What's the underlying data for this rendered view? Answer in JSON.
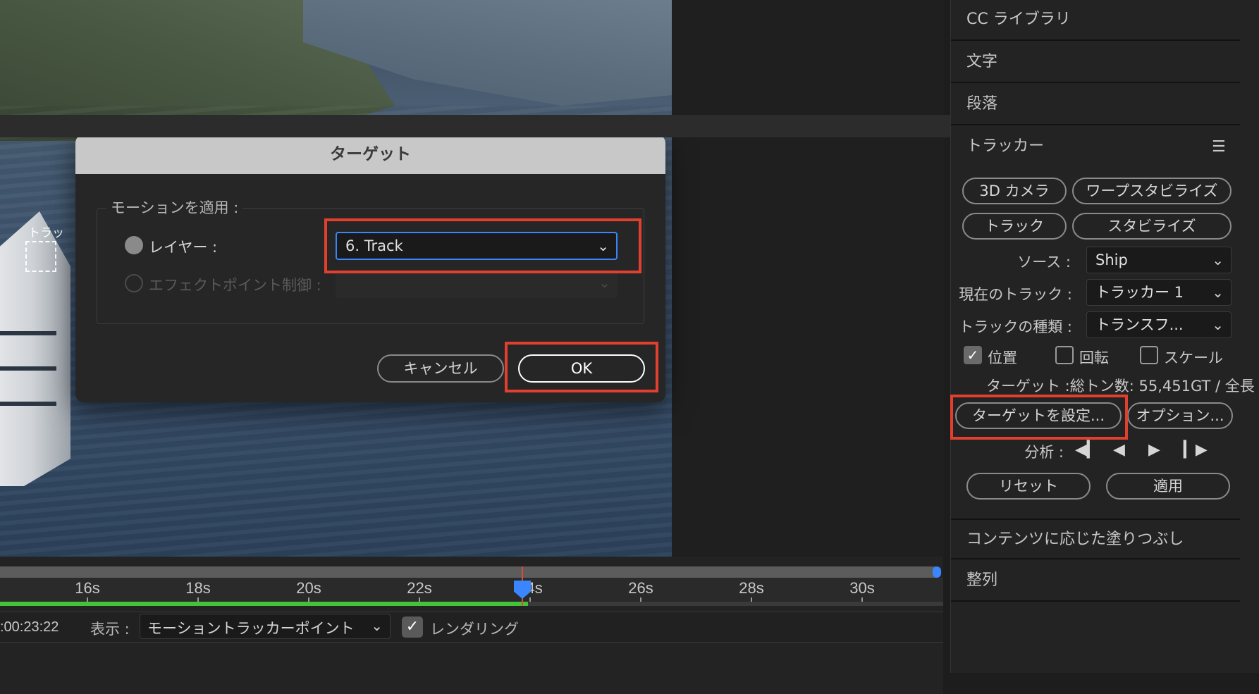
{
  "preview": {
    "track_label": "トラッ"
  },
  "timeline": {
    "ticks": [
      "16s",
      "18s",
      "20s",
      "22s",
      "24s",
      "26s",
      "28s",
      "30s"
    ],
    "timecode": ":00:23:22",
    "show_label": "表示 :",
    "show_value": "モーショントラッカーポイント",
    "render_label": "レンダリング",
    "render_checked": true,
    "rendered_fraction": 0.56
  },
  "panels": {
    "cc_library": "CC ライブラリ",
    "character": "文字",
    "paragraph": "段落",
    "tracker": "トラッカー",
    "content_aware_fill": "コンテンツに応じた塗りつぶし",
    "align": "整列"
  },
  "tracker": {
    "buttons": {
      "camera3d": "3D カメラ",
      "warp_stabilize": "ワープスタビライズ",
      "track": "トラック",
      "stabilize": "スタビライズ"
    },
    "source_label": "ソース :",
    "source_value": "Ship",
    "current_track_label": "現在のトラック :",
    "current_track_value": "トラッカー 1",
    "track_type_label": "トラックの種類 :",
    "track_type_value": "トランスフ...",
    "checks": {
      "position": {
        "label": "位置",
        "checked": true
      },
      "rotation": {
        "label": "回転",
        "checked": false
      },
      "scale": {
        "label": "スケール",
        "checked": false
      }
    },
    "target_info": "ターゲット :総トン数: 55,451GT / 全長",
    "set_target": "ターゲットを設定...",
    "options": "オプション...",
    "analyze_label": "分析 :",
    "analyze_icons": [
      "step-back-icon",
      "play-backward-icon",
      "play-forward-icon",
      "step-forward-icon"
    ],
    "reset": "リセット",
    "apply": "適用"
  },
  "dialog": {
    "title": "ターゲット",
    "group_title": "モーションを適用 :",
    "layer_label": "レイヤー :",
    "layer_value": "6. Track",
    "effect_label": "エフェクトポイント制御 :",
    "cancel": "キャンセル",
    "ok": "OK"
  },
  "colors": {
    "highlight": "#e2402f",
    "accent": "#3a86ff",
    "render_bar": "#46c23a"
  }
}
